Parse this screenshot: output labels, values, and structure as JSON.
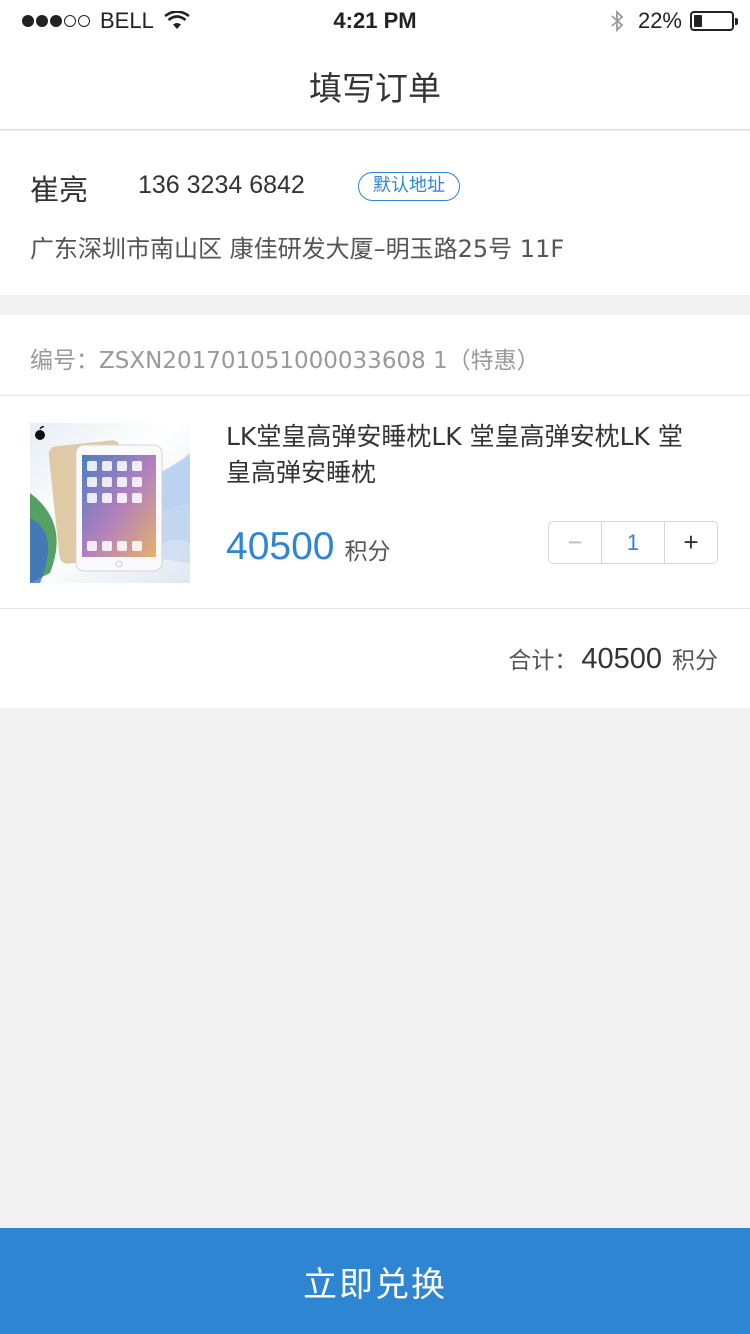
{
  "status_bar": {
    "carrier": "BELL",
    "time": "4:21 PM",
    "battery": "22%",
    "battery_level": 0.22,
    "signal_icon": "signal-dots-icon",
    "wifi_icon": "wifi-icon",
    "bluetooth_icon": "bluetooth-icon"
  },
  "nav": {
    "title": "填写订单"
  },
  "address": {
    "name": "崔亮",
    "phone": "136 3234 6842",
    "badge": "默认地址",
    "detail": "广东深圳市南山区  康佳研发大厦–明玉路25号 11F"
  },
  "order": {
    "number": "编号：ZSXN201701051000033608 1（特惠）",
    "product": {
      "image_icon": "tablet-product-image",
      "name": "LK堂皇高弹安睡枕LK 堂皇高弹安枕LK 堂皇高弹安睡枕",
      "price": "40500",
      "price_unit": "积分"
    },
    "quantity": {
      "minus": "−",
      "value": "1",
      "plus": "+"
    },
    "total": {
      "label": "合计：",
      "value": "40500",
      "unit": "积分"
    }
  },
  "submit_button": "立即兑换",
  "colors": {
    "accent": "#2e86d2",
    "background": "#f2f2f2"
  }
}
